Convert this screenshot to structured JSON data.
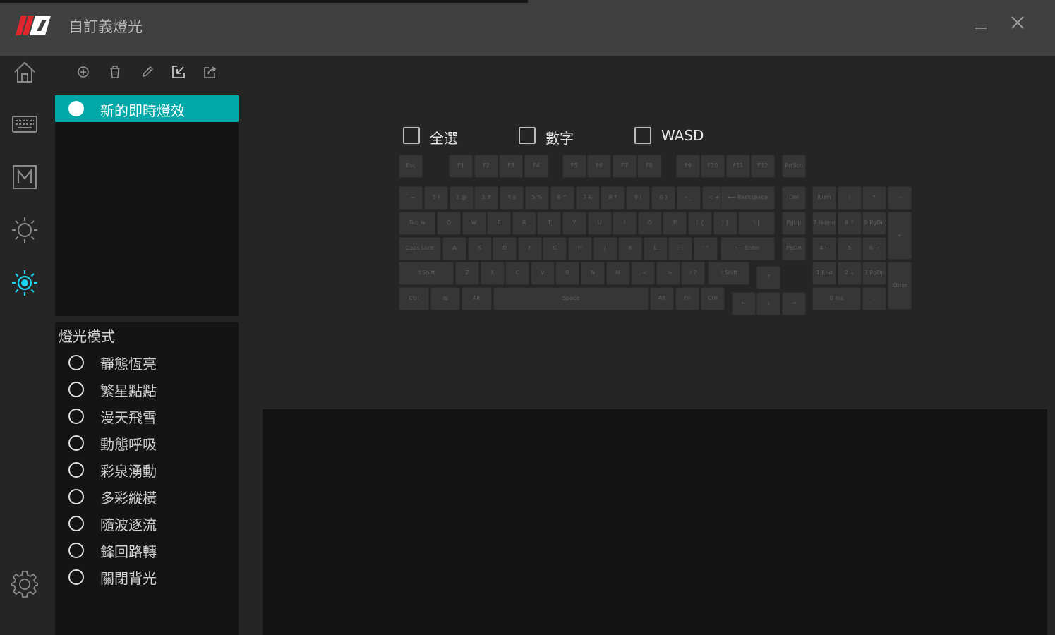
{
  "window": {
    "title": "自訂義燈光",
    "minimize_icon": "minimize-icon",
    "close_icon": "close-icon"
  },
  "colors": {
    "accent": "#00a8a8",
    "active_icon": "#19d3f0",
    "logo_red": "#e0262d"
  },
  "sidebar": {
    "items": [
      {
        "name": "home",
        "icon": "home-icon"
      },
      {
        "name": "keyboard",
        "icon": "keyboard-icon"
      },
      {
        "name": "macro",
        "icon": "macro-m-icon"
      },
      {
        "name": "brightness",
        "icon": "sun-icon"
      },
      {
        "name": "custom-lighting",
        "icon": "sun-active-icon",
        "active": true
      }
    ],
    "settings_icon": "gear-icon"
  },
  "toolbar": {
    "icons": [
      "add-icon",
      "delete-icon",
      "edit-icon",
      "import-icon",
      "export-icon"
    ]
  },
  "profiles": [
    {
      "label": "新的即時燈效",
      "selected": true
    }
  ],
  "modes": {
    "title": "燈光模式",
    "items": [
      "靜態恆亮",
      "繁星點點",
      "漫天飛雪",
      "動態呼吸",
      "彩泉湧動",
      "多彩縱橫",
      "隨波逐流",
      "鋒回路轉",
      "關閉背光"
    ]
  },
  "selection": {
    "all": "全選",
    "numbers": "數字",
    "wasd": "WASD"
  },
  "keys": {
    "fn_row": [
      "Esc",
      "F1",
      "F2",
      "F3",
      "F4",
      "F5",
      "F6",
      "F7",
      "F8",
      "F9",
      "F10",
      "F11",
      "F12",
      "PrtScn"
    ],
    "num_row": [
      "` ~",
      "1 !",
      "2 @",
      "3 #",
      "4 $",
      "5 %",
      "6 ^",
      "7 &",
      "8 *",
      "9 (",
      "0 )",
      "- _",
      "= +",
      "⟵ Backspace",
      "Del"
    ],
    "tab_row": [
      "Tab ⇆",
      "Q",
      "W",
      "E",
      "R",
      "T",
      "Y",
      "U",
      "I",
      "O",
      "P",
      "[ {",
      "] }",
      "\\ |",
      "PgUp"
    ],
    "caps_row": [
      "Caps Lock",
      "A",
      "S",
      "D",
      "F",
      "G",
      "H",
      "J",
      "K",
      "L",
      "; :",
      "' \"",
      "⟵ Enter",
      "PgDn"
    ],
    "shift_row": [
      "⇧Shift",
      "Z",
      "X",
      "C",
      "V",
      "B",
      "N",
      "M",
      ", <",
      ". >",
      "/ ?",
      "⇧Shift"
    ],
    "ctrl_row": [
      "Ctrl",
      "⊞",
      "Alt",
      "Space",
      "Alt",
      "Fn",
      "Ctrl"
    ],
    "arrows": [
      "↑",
      "←",
      "↓",
      "→"
    ],
    "numpad": [
      "Num",
      "/",
      "*",
      "-",
      "7 Home",
      "8 ↑",
      "9 PgDn",
      "+",
      "4 ←",
      "5",
      "6 →",
      "1 End",
      "2 ↓",
      "3 PgDn",
      "Enter",
      "0 Ins",
      "."
    ]
  }
}
